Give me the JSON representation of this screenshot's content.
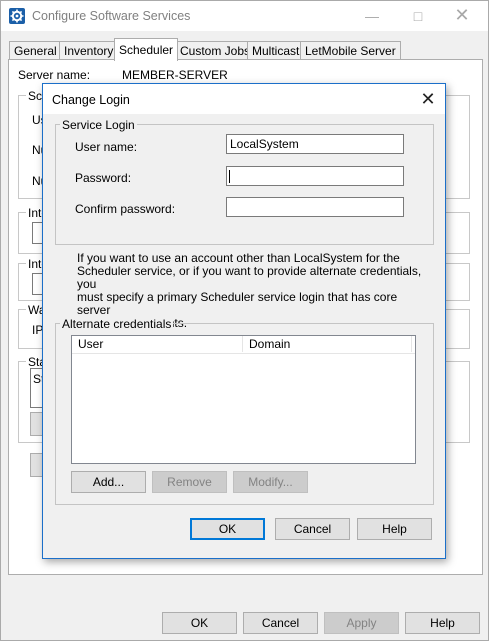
{
  "window": {
    "title": "Configure Software Services"
  },
  "tabs": [
    "General",
    "Inventory",
    "Scheduler",
    "Custom Jobs",
    "Multicast",
    "LetMobile Server"
  ],
  "server": {
    "label": "Server name:",
    "value": "MEMBER-SERVER"
  },
  "background_fragments": [
    "Sch",
    "Us",
    "Nu",
    "Nu",
    "Inte",
    "Inte",
    "Wa",
    "IP",
    "Sta",
    "St"
  ],
  "dialog": {
    "title": "Change Login",
    "service_login": {
      "group_label": "Service Login",
      "user_label": "User name:",
      "user_value": "LocalSystem",
      "password_label": "Password:",
      "password_value": "",
      "confirm_label": "Confirm password:",
      "confirm_value": ""
    },
    "info_lines": [
      "If you want to use an account other than LocalSystem for the",
      "Scheduler service, or if you want to provide alternate credentials, you",
      "must specify a primary Scheduler service login that has core server",
      "administrative rights."
    ],
    "alt_credentials": {
      "group_label": "Alternate credentials",
      "columns": [
        "User",
        "Domain"
      ],
      "add": "Add...",
      "remove": "Remove",
      "modify": "Modify..."
    },
    "ok": "OK",
    "cancel": "Cancel",
    "help": "Help"
  },
  "footer": {
    "ok": "OK",
    "cancel": "Cancel",
    "apply": "Apply",
    "help": "Help"
  }
}
